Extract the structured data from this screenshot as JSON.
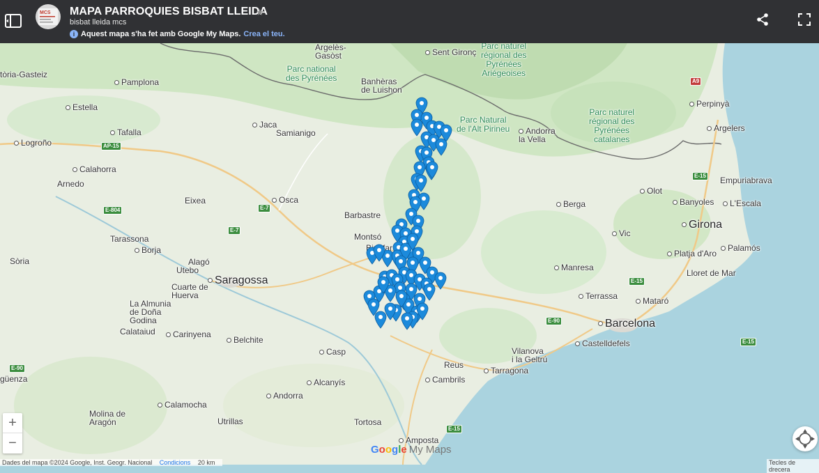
{
  "header": {
    "title": "MAPA PARROQUIES BISBAT LLEIDA",
    "author": "bisbat lleida mcs",
    "info_text": "Aquest mapa s'ha fet amb Google My Maps.",
    "info_link": "Crea el teu.",
    "logo_text": "MCS"
  },
  "map": {
    "places": [
      {
        "id": "argeles-gasost",
        "text": "Argelès-\nGasòst"
      },
      {
        "id": "sent-gironc",
        "text": "Sent Gironç"
      },
      {
        "id": "pamplona",
        "text": "Pamplona"
      },
      {
        "id": "estella",
        "text": "Estella"
      },
      {
        "id": "tafalla",
        "text": "Tafalla"
      },
      {
        "id": "logrono",
        "text": "Logroño"
      },
      {
        "id": "calahorra",
        "text": "Calahorra"
      },
      {
        "id": "arnedo",
        "text": "Arnedo"
      },
      {
        "id": "jaca",
        "text": "Jaca"
      },
      {
        "id": "samianigo",
        "text": "Samianigo"
      },
      {
        "id": "banheras",
        "text": "Banhèras\nde Luishon"
      },
      {
        "id": "andorra",
        "text": "Andorra\nla Vella"
      },
      {
        "id": "perpinya",
        "text": "Perpinyà"
      },
      {
        "id": "argelers",
        "text": "Argelers"
      },
      {
        "id": "olot",
        "text": "Olot"
      },
      {
        "id": "empuriabrava",
        "text": "Empuriabrava"
      },
      {
        "id": "banyoles",
        "text": "Banyoles"
      },
      {
        "id": "lescala",
        "text": "L'Escala"
      },
      {
        "id": "girona",
        "text": "Girona"
      },
      {
        "id": "berga",
        "text": "Berga"
      },
      {
        "id": "vic",
        "text": "Vic"
      },
      {
        "id": "platja",
        "text": "Platja d'Aro"
      },
      {
        "id": "palamos",
        "text": "Palamós"
      },
      {
        "id": "lloret",
        "text": "Lloret de Mar"
      },
      {
        "id": "manresa",
        "text": "Manresa"
      },
      {
        "id": "terrassa",
        "text": "Terrassa"
      },
      {
        "id": "mataro",
        "text": "Mataró"
      },
      {
        "id": "barcelona",
        "text": "Barcelona"
      },
      {
        "id": "castelldefels",
        "text": "Castelldefels"
      },
      {
        "id": "vilanova",
        "text": "Vilanova\ni la Geltrú"
      },
      {
        "id": "tarragona",
        "text": "Tarragona"
      },
      {
        "id": "reus",
        "text": "Reus"
      },
      {
        "id": "cambrils",
        "text": "Cambrils"
      },
      {
        "id": "eixea",
        "text": "Eixea"
      },
      {
        "id": "osca",
        "text": "Osca"
      },
      {
        "id": "barbastre",
        "text": "Barbastre"
      },
      {
        "id": "montso",
        "text": "Montsó"
      },
      {
        "id": "binefar",
        "text": "Binèfar"
      },
      {
        "id": "tarassona",
        "text": "Tarassona"
      },
      {
        "id": "borja",
        "text": "Borja"
      },
      {
        "id": "alago",
        "text": "Alagó"
      },
      {
        "id": "utebo",
        "text": "Utebo"
      },
      {
        "id": "saragossa",
        "text": "Saragossa"
      },
      {
        "id": "cuarte",
        "text": "Cuarte de\nHuerva"
      },
      {
        "id": "almunia",
        "text": "La Almunia\nde Doña\nGodina"
      },
      {
        "id": "calataiud",
        "text": "Calataiud"
      },
      {
        "id": "carinyena",
        "text": "Carinyena"
      },
      {
        "id": "belchite",
        "text": "Belchite"
      },
      {
        "id": "casp",
        "text": "Casp"
      },
      {
        "id": "alcanyis",
        "text": "Alcanyís"
      },
      {
        "id": "andorra-teruel",
        "text": "Andorra"
      },
      {
        "id": "calamocha",
        "text": "Calamocha"
      },
      {
        "id": "molina",
        "text": "Molina de\nAragón"
      },
      {
        "id": "utrillas",
        "text": "Utrillas"
      },
      {
        "id": "tortosa",
        "text": "Tortosa"
      },
      {
        "id": "amposta",
        "text": "Amposta"
      },
      {
        "id": "soria",
        "text": "Sòria"
      },
      {
        "id": "vitoria",
        "text": "tòria-Gasteiz"
      },
      {
        "id": "siguenza",
        "text": "güenza"
      }
    ],
    "parks": [
      {
        "id": "pyrenees-ariegeoises",
        "text": "Parc naturel\nrégional des\nPyrénées\nAriégeoises"
      },
      {
        "id": "parc-national",
        "text": "Parc national\ndes Pyrénées"
      },
      {
        "id": "alt-pirineu",
        "text": "Parc Natural\nde l'Alt Pirineu"
      },
      {
        "id": "pyrenees-catalanes",
        "text": "Parc naturel\nrégional des\nPyrénées\ncatalanes"
      }
    ],
    "roads": [
      "A9",
      "E-15",
      "E-15",
      "E-15",
      "E-15",
      "E-90",
      "E-90",
      "AP-15",
      "E-804",
      "E-7",
      "E-7"
    ],
    "pin_color": "#1c8adb",
    "pin_count": 68
  },
  "controls": {
    "zoom_in": "+",
    "zoom_out": "−"
  },
  "footer": {
    "attribution": "Dades del mapa ©2024 Google, Inst. Geogr. Nacional",
    "terms": "Condicions",
    "scale": "20 km",
    "shortcuts": "Tecles de drecera",
    "brand_my_maps": "My Maps"
  }
}
